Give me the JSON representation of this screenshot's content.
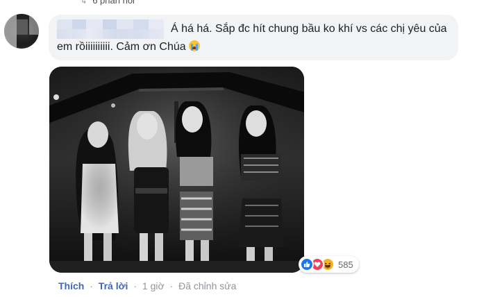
{
  "comment": {
    "replies_link": "6 phản hồi",
    "text": "Á há há. Sắp đc hít chung bầu ko khí vs các chị yêu của em rồiiiiiiiiii. Cảm ơn Chúa",
    "emoji": "loudly-crying-face",
    "reactions": {
      "icons": [
        "like",
        "love",
        "haha"
      ],
      "count": "585",
      "colors": {
        "like": "#1877f2",
        "love": "#f33e58",
        "haha": "#f7b125"
      }
    },
    "actions": {
      "like": "Thích",
      "reply": "Trả lời",
      "separator": "·",
      "time": "1 giờ",
      "edited": "Đã chỉnh sửa"
    }
  }
}
